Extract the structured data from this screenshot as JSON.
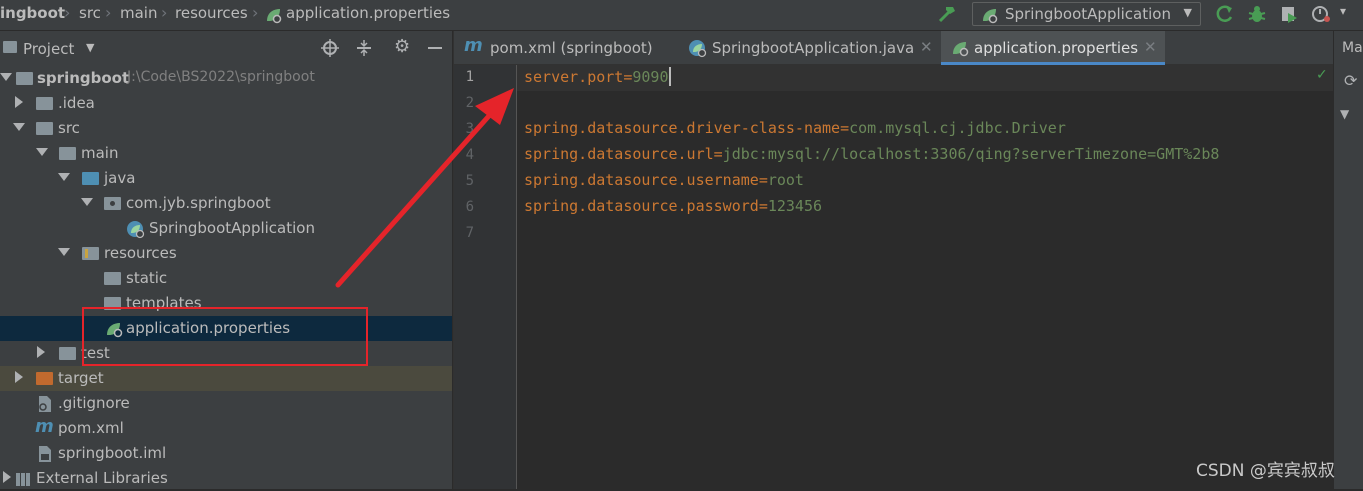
{
  "breadcrumb": [
    "ingboot",
    "src",
    "main",
    "resources",
    "application.properties"
  ],
  "toolbar": {
    "run_config": "SpringbootApplication",
    "icons": [
      "hammer-icon",
      "rerun-icon",
      "debug-icon",
      "coverage-icon",
      "profiler-icon"
    ]
  },
  "project": {
    "title": "Project",
    "tree": [
      {
        "label": "springboot",
        "hint": "J:\\Code\\BS2022\\springboot"
      },
      {
        "label": ".idea"
      },
      {
        "label": "src"
      },
      {
        "label": "main"
      },
      {
        "label": "java"
      },
      {
        "label": "com.jyb.springboot"
      },
      {
        "label": "SpringbootApplication"
      },
      {
        "label": "resources"
      },
      {
        "label": "static"
      },
      {
        "label": "templates"
      },
      {
        "label": "application.properties"
      },
      {
        "label": "test"
      },
      {
        "label": "target"
      },
      {
        "label": ".gitignore"
      },
      {
        "label": "pom.xml"
      },
      {
        "label": "springboot.iml"
      },
      {
        "label": "External Libraries"
      }
    ]
  },
  "editor": {
    "tabs": [
      {
        "label": "pom.xml (springboot)"
      },
      {
        "label": "SpringbootApplication.java"
      },
      {
        "label": "application.properties"
      }
    ],
    "line_numbers": [
      "1",
      "2",
      "3",
      "4",
      "5",
      "6",
      "7"
    ],
    "lines": [
      {
        "key": "server.port",
        "eq": "=",
        "val": "9090"
      },
      {
        "key": "",
        "eq": "",
        "val": ""
      },
      {
        "key": "spring.datasource.driver-class-name",
        "eq": "=",
        "val": "com.mysql.cj.jdbc.Driver"
      },
      {
        "key": "spring.datasource.url",
        "eq": "=",
        "val": "jdbc:mysql://localhost:3306/qing?serverTimezone=GMT%2b8"
      },
      {
        "key": "spring.datasource.username",
        "eq": "=",
        "val": "root"
      },
      {
        "key": "spring.datasource.password",
        "eq": "=",
        "val": "123456"
      },
      {
        "key": "",
        "eq": "",
        "val": ""
      }
    ]
  },
  "right_panel": {
    "label": "Ma"
  },
  "watermark": "CSDN @宾宾叔叔",
  "colors": {
    "annotation": "#e5242a",
    "selection": "#0d293e",
    "keyword": "#cc7832",
    "string": "#6a8759"
  }
}
